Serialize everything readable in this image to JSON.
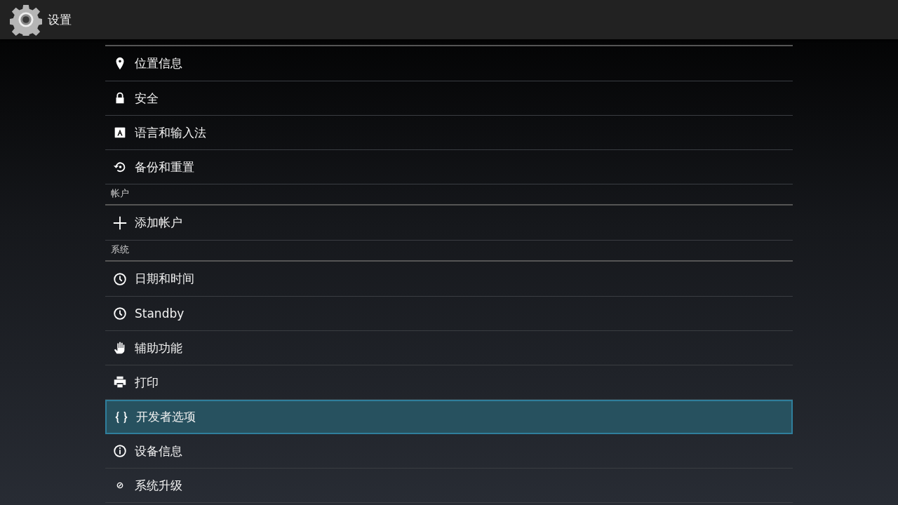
{
  "app_bar": {
    "title": "设置"
  },
  "sections": [
    {
      "items": [
        {
          "kind": "location",
          "label": "位置信息",
          "selected": false
        },
        {
          "kind": "lock",
          "label": "安全",
          "selected": false
        },
        {
          "kind": "language",
          "label": "语言和输入法",
          "selected": false
        },
        {
          "kind": "restore",
          "label": "备份和重置",
          "selected": false
        }
      ]
    },
    {
      "header": "帐户",
      "items": [
        {
          "kind": "add",
          "label": "添加帐户",
          "selected": false
        }
      ]
    },
    {
      "header": "系统",
      "items": [
        {
          "kind": "clock",
          "label": "日期和时间",
          "selected": false
        },
        {
          "kind": "clock",
          "label": "Standby",
          "selected": false
        },
        {
          "kind": "hand",
          "label": "辅助功能",
          "selected": false
        },
        {
          "kind": "print",
          "label": "打印",
          "selected": false
        },
        {
          "kind": "braces",
          "label": "开发者选项",
          "selected": true
        },
        {
          "kind": "info",
          "label": "设备信息",
          "selected": false
        },
        {
          "kind": "update",
          "label": "系统升级",
          "selected": false
        }
      ]
    }
  ]
}
